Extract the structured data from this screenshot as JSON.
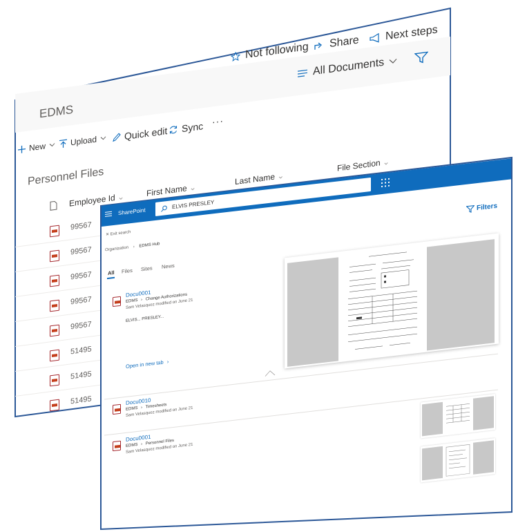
{
  "library": {
    "title": "EDMS",
    "top_actions": [
      {
        "label": "Not following",
        "icon": "star-icon"
      },
      {
        "label": "Share",
        "icon": "share-icon"
      },
      {
        "label": "Next steps",
        "icon": "megaphone-icon"
      }
    ],
    "view_label": "All Documents",
    "commands": [
      {
        "label": "New",
        "icon": "plus-icon"
      },
      {
        "label": "Upload",
        "icon": "upload-icon"
      },
      {
        "label": "Quick edit",
        "icon": "pencil-icon"
      },
      {
        "label": "Sync",
        "icon": "sync-icon"
      },
      {
        "label": "···",
        "icon": "more-icon"
      }
    ],
    "list_title": "Personnel Files",
    "columns": [
      "Employee Id",
      "First Name",
      "Last Name",
      "File Section"
    ],
    "rows": [
      "99567",
      "99567",
      "99567",
      "99567",
      "99567",
      "51495",
      "51495",
      "51495"
    ]
  },
  "search": {
    "brand": "SharePoint",
    "query": "ELVIS PRESLEY",
    "exit_label": "Exit search",
    "breadcrumb": [
      "Organization",
      "EDMS Hub"
    ],
    "filters_label": "Filters",
    "tabs": [
      "All",
      "Files",
      "Sites",
      "News"
    ],
    "results": [
      {
        "title": "Docu0001",
        "site": "EDMS",
        "library": "Change Authorizations",
        "author": "Sam Velasquez",
        "modified": "modified on June 21",
        "snippet": "ELVIS... PRESLEY...",
        "open_label": "Open in new tab"
      },
      {
        "title": "Docu0010",
        "site": "EDMS",
        "library": "Timesheets",
        "author": "Sam Velasquez",
        "modified": "modified on June 21"
      },
      {
        "title": "Docu0001",
        "site": "EDMS",
        "library": "Personnel Files",
        "author": "Sam Velasquez",
        "modified": "modified on June 21"
      }
    ]
  },
  "colors": {
    "accent": "#0f6cbd",
    "frame": "#2b5797",
    "pdf": "#c43e1c"
  }
}
